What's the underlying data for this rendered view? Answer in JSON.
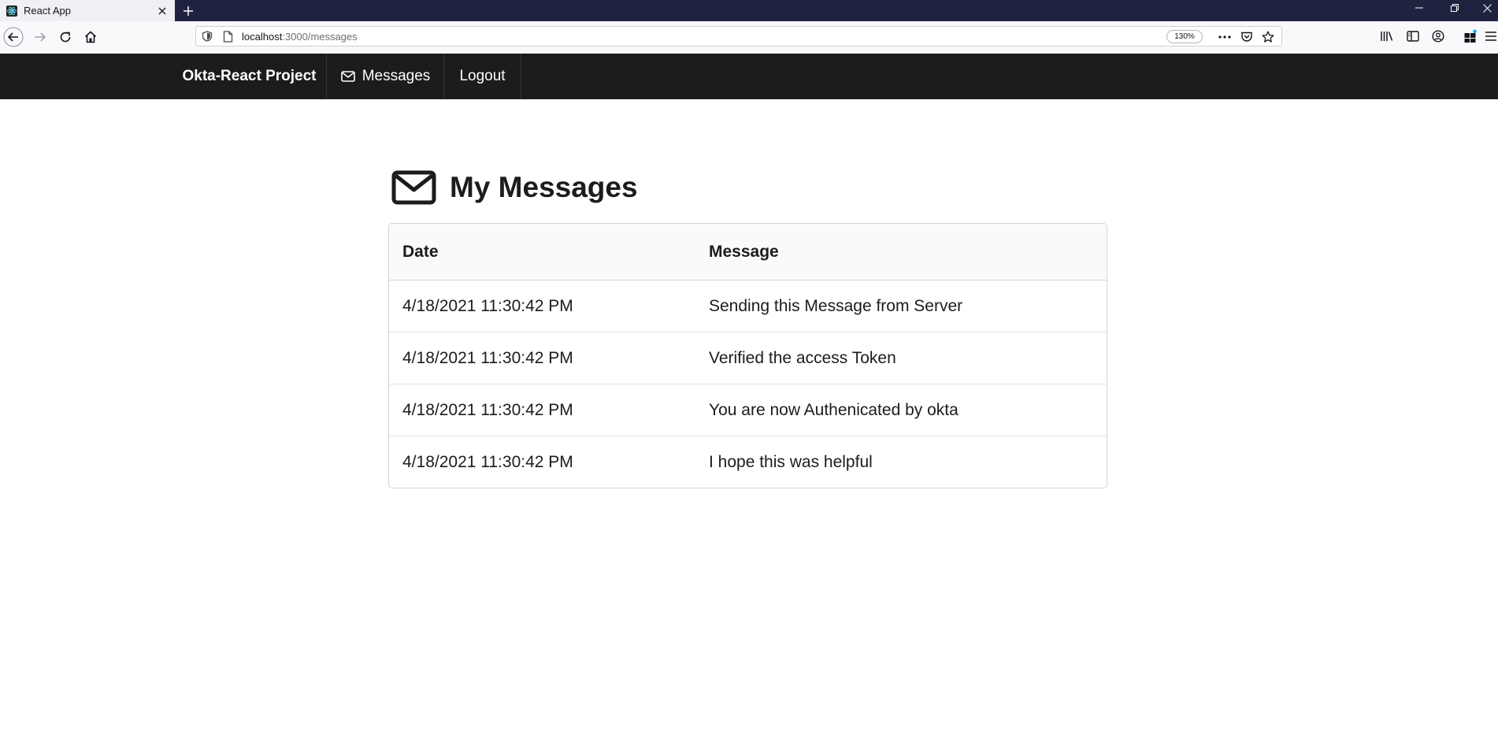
{
  "browser": {
    "tab_title": "React App",
    "url_host": "localhost",
    "url_path": ":3000/messages",
    "zoom": "130%"
  },
  "app": {
    "brand": "Okta-React Project",
    "nav_messages": "Messages",
    "nav_logout": "Logout"
  },
  "page": {
    "title": "My Messages"
  },
  "table": {
    "headers": {
      "date": "Date",
      "message": "Message"
    },
    "rows": [
      {
        "date": "4/18/2021 11:30:42 PM",
        "message": "Sending this Message from Server"
      },
      {
        "date": "4/18/2021 11:30:42 PM",
        "message": "Verified the access Token"
      },
      {
        "date": "4/18/2021 11:30:42 PM",
        "message": "You are now Authenicated by okta"
      },
      {
        "date": "4/18/2021 11:30:42 PM",
        "message": "I hope this was helpful"
      }
    ]
  },
  "icons": {
    "favicon": "react-icon",
    "messages": "envelope-icon"
  },
  "colors": {
    "tabstrip": "#202340",
    "appbar": "#1b1c1d",
    "table_header_bg": "#f9fafb"
  }
}
